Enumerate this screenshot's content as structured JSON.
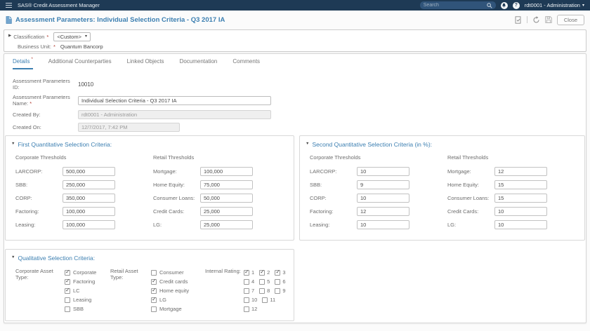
{
  "colors": {
    "topbar_bg": "#1e3a55",
    "accent_blue": "#3c7fb1",
    "required_red": "#b03a2e",
    "label_gray": "#6d6d6d"
  },
  "glyphs": {
    "required": "*",
    "caret_down": "▾",
    "collapsed": "▶",
    "expanded": "▼",
    "question": "?"
  },
  "topbar": {
    "app_title": "SAS® Credit Assessment Manager",
    "search_placeholder": "Search",
    "user_menu": "rdt0001 - Administration"
  },
  "header": {
    "title": "Assessment Parameters: Individual Selection Criteria - Q3 2017 IA",
    "close_label": "Close"
  },
  "classification": {
    "label": "Classification",
    "dropdown_value": "<Custom>",
    "business_unit_label": "Business Unit:",
    "business_unit_value": "Quantum Bancorp"
  },
  "tabs": [
    {
      "label": "Details"
    },
    {
      "label": "Additional Counterparties"
    },
    {
      "label": "Linked Objects"
    },
    {
      "label": "Documentation"
    },
    {
      "label": "Comments"
    }
  ],
  "details": {
    "id_label": "Assessment Parameters ID:",
    "id_value": "10010",
    "name_label": "Assessment Parameters Name:",
    "name_value": "Individual Selection Criteria - Q3 2017 IA",
    "created_by_label": "Created By:",
    "created_by_value": "rdt0001 - Administration",
    "created_on_label": "Created On:",
    "created_on_value": "12/7/2017, 7:42 PM"
  },
  "first_quant": {
    "title": "First Quantitative Selection Criteria:",
    "corporate_header": "Corporate Thresholds",
    "retail_header": "Retail Thresholds",
    "corporate": [
      {
        "label": "LARCORP:",
        "value": "500,000"
      },
      {
        "label": "SBB:",
        "value": "250,000"
      },
      {
        "label": "CORP:",
        "value": "350,000"
      },
      {
        "label": "Factoring:",
        "value": "100,000"
      },
      {
        "label": "Leasing:",
        "value": "100,000"
      }
    ],
    "retail": [
      {
        "label": "Mortgage:",
        "value": "100,000"
      },
      {
        "label": "Home Equity:",
        "value": "75,000"
      },
      {
        "label": "Consumer Loans:",
        "value": "50,000"
      },
      {
        "label": "Credit Cards:",
        "value": "25,000"
      },
      {
        "label": "LG:",
        "value": "25,000"
      }
    ]
  },
  "second_quant": {
    "title": "Second Quantitative Selection Criteria (in %):",
    "corporate_header": "Corporate Thresholds",
    "retail_header": "Retail Thresholds",
    "corporate": [
      {
        "label": "LARCORP:",
        "value": "10"
      },
      {
        "label": "SBB:",
        "value": "9"
      },
      {
        "label": "CORP:",
        "value": "10"
      },
      {
        "label": "Factoring:",
        "value": "12"
      },
      {
        "label": "Leasing:",
        "value": "10"
      }
    ],
    "retail": [
      {
        "label": "Mortgage:",
        "value": "12"
      },
      {
        "label": "Home Equity:",
        "value": "15"
      },
      {
        "label": "Consumer Loans:",
        "value": "15"
      },
      {
        "label": "Credit Cards:",
        "value": "10"
      },
      {
        "label": "LG:",
        "value": "10"
      }
    ]
  },
  "qualitative": {
    "title": "Qualitative Selection Criteria:",
    "corporate_label": "Corporate Asset Type:",
    "retail_label": "Retail Asset Type:",
    "rating_label": "Internal Rating:",
    "corporate_options": [
      {
        "label": "Corporate",
        "checked": true
      },
      {
        "label": "Factoring",
        "checked": true
      },
      {
        "label": "LC",
        "checked": true
      },
      {
        "label": "Leasing",
        "checked": false
      },
      {
        "label": "SBB",
        "checked": false
      }
    ],
    "retail_options": [
      {
        "label": "Consumer",
        "checked": false
      },
      {
        "label": "Credit cards",
        "checked": true
      },
      {
        "label": "Home equity",
        "checked": true
      },
      {
        "label": "LG",
        "checked": true
      },
      {
        "label": "Mortgage",
        "checked": false
      }
    ],
    "rating_options": [
      {
        "label": "1",
        "checked": true
      },
      {
        "label": "2",
        "checked": true
      },
      {
        "label": "3",
        "checked": true
      },
      {
        "label": "4",
        "checked": false
      },
      {
        "label": "5",
        "checked": false
      },
      {
        "label": "6",
        "checked": false
      },
      {
        "label": "7",
        "checked": false
      },
      {
        "label": "8",
        "checked": false
      },
      {
        "label": "9",
        "checked": false
      },
      {
        "label": "10",
        "checked": false
      },
      {
        "label": "11",
        "checked": false
      },
      {
        "label": "12",
        "checked": false
      }
    ]
  }
}
